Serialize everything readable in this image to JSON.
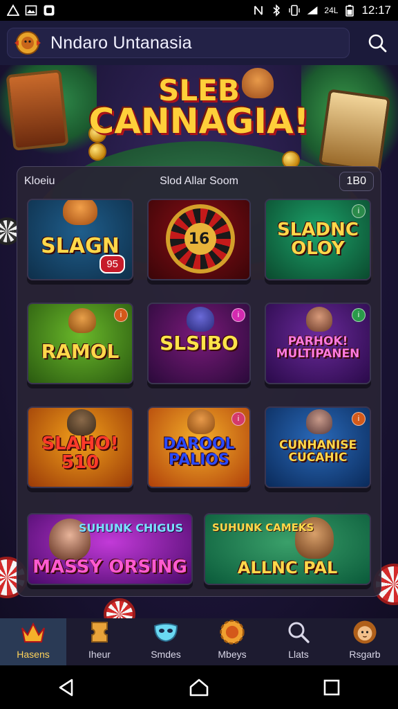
{
  "status_bar": {
    "time": "12:1​7",
    "icons_left": [
      "warning-icon",
      "image-icon",
      "app-icon"
    ],
    "icons_right": [
      "nfc-icon",
      "bluetooth-icon",
      "vibrate-icon",
      "signal-icon",
      "battery-icon"
    ],
    "network_label": "24L"
  },
  "app_bar": {
    "title": "Nndaro Untanasia",
    "logo_icon": "lion-logo-icon",
    "search_icon": "search-icon"
  },
  "hero": {
    "title_line1": "SLEB",
    "title_line2": "CANNAGIA!"
  },
  "panel": {
    "left_label": "Kloeiu",
    "center_label": "Slod Allar Soom",
    "right_badge": "1B0"
  },
  "tiles": [
    {
      "title": "SLAGN",
      "badge": "95",
      "colors": [
        "#1f5e8c",
        "#0e2f4a"
      ],
      "text_color": "#ffd84a"
    },
    {
      "title": "16",
      "colors": [
        "#8a0f16",
        "#3a0508"
      ],
      "text_color": "#1a1a1a"
    },
    {
      "title": "SLADNC OLOY",
      "colors": [
        "#1ca36a",
        "#0b4a2e"
      ],
      "text_color": "#ffd84a"
    },
    {
      "title": "RAMOL",
      "colors": [
        "#6ab82a",
        "#2a5a10"
      ],
      "text_color": "#ffd84a"
    },
    {
      "title": "SLSIBO",
      "colors": [
        "#7a1a7a",
        "#2a0a3a"
      ],
      "text_color": "#ffe34a"
    },
    {
      "title": "PARHOK! MULTIPANEN",
      "colors": [
        "#6a2a9a",
        "#2a0a4a"
      ],
      "text_color": "#ff7ae0"
    },
    {
      "title": "SLAHO! 510",
      "colors": [
        "#f2a01a",
        "#9a3a08"
      ],
      "text_color": "#ff3a2a"
    },
    {
      "title": "DAROOL PALIOS",
      "colors": [
        "#f5b02a",
        "#b0400a"
      ],
      "text_color": "#2a4aff"
    },
    {
      "title": "CUNHANISE CUCAHIC",
      "colors": [
        "#2a6aba",
        "#0a2a5a"
      ],
      "text_color": "#ffd84a"
    },
    {
      "title": "MASSY ORSING",
      "subtitle": "SUHUNK CHIGUS",
      "colors": [
        "#c23ad8",
        "#4a0a6a"
      ],
      "text_color": "#ff5ad0"
    },
    {
      "title": "ALLNC PAL",
      "subtitle": "SUHUNK CAMEKS",
      "colors": [
        "#3aa06a",
        "#0a5a3a"
      ],
      "text_color": "#ffd84a"
    }
  ],
  "bottom_nav": [
    {
      "label": "Hasens",
      "icon": "crown-icon",
      "active": true
    },
    {
      "label": "Iheur",
      "icon": "ticket-icon",
      "active": false
    },
    {
      "label": "Smdes",
      "icon": "mask-icon",
      "active": false
    },
    {
      "label": "Mbeys",
      "icon": "gear-coin-icon",
      "active": false
    },
    {
      "label": "Llats",
      "icon": "search-icon",
      "active": false
    },
    {
      "label": "Rsgarb",
      "icon": "lion-icon",
      "active": false
    }
  ],
  "system_nav": [
    "back-icon",
    "home-icon",
    "recents-icon"
  ]
}
